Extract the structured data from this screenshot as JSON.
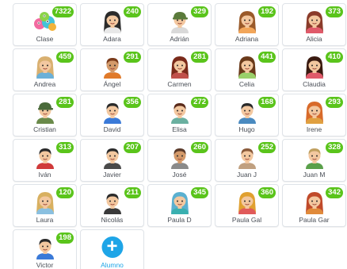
{
  "class_card": {
    "label": "Clase",
    "points": "7322"
  },
  "students": [
    {
      "name": "Adara",
      "points": "240",
      "hair": "#2b2b2b",
      "skin": "#f3c8a0",
      "shirt": "#e8e8e8",
      "hairstyle": "long"
    },
    {
      "name": "Adrián",
      "points": "329",
      "hair": "#5a7a3a",
      "skin": "#f3c8a0",
      "shirt": "#d9d9d9",
      "hairstyle": "cap"
    },
    {
      "name": "Adriana",
      "points": "192",
      "hair": "#9a5a2a",
      "skin": "#f3c8a0",
      "shirt": "#f2a65a",
      "hairstyle": "long"
    },
    {
      "name": "Alicia",
      "points": "373",
      "hair": "#8a3b2a",
      "skin": "#f3c8a0",
      "shirt": "#e05a6a",
      "hairstyle": "long"
    },
    {
      "name": "Andrea",
      "points": "459",
      "hair": "#d9b070",
      "skin": "#f3c8a0",
      "shirt": "#6ab0d8",
      "hairstyle": "long"
    },
    {
      "name": "Ángel",
      "points": "291",
      "hair": "#7a3a1a",
      "skin": "#d49a6a",
      "shirt": "#e07a2a",
      "hairstyle": "short"
    },
    {
      "name": "Carmen",
      "points": "281",
      "hair": "#7a2a1a",
      "skin": "#f3c8a0",
      "shirt": "#c0504a",
      "hairstyle": "long"
    },
    {
      "name": "Celia",
      "points": "441",
      "hair": "#6a3a1a",
      "skin": "#f3c8a0",
      "shirt": "#9ad06a",
      "hairstyle": "long"
    },
    {
      "name": "Claudia",
      "points": "410",
      "hair": "#3a1a10",
      "skin": "#f3c8a0",
      "shirt": "#e05a6a",
      "hairstyle": "long"
    },
    {
      "name": "Cristian",
      "points": "281",
      "hair": "#4a6a3a",
      "skin": "#f3c8a0",
      "shirt": "#6a8a4a",
      "hairstyle": "cap"
    },
    {
      "name": "David",
      "points": "356",
      "hair": "#2a2a2a",
      "skin": "#f3c8a0",
      "shirt": "#3a7ad8",
      "hairstyle": "short"
    },
    {
      "name": "Elisa",
      "points": "272",
      "hair": "#5a2a1a",
      "skin": "#f3c8a0",
      "shirt": "#6ab0a0",
      "hairstyle": "short"
    },
    {
      "name": "Hugo",
      "points": "168",
      "hair": "#2a2a2a",
      "skin": "#f3c8a0",
      "shirt": "#4a8ac0",
      "hairstyle": "short"
    },
    {
      "name": "Irene",
      "points": "293",
      "hair": "#d86a2a",
      "skin": "#f3c8a0",
      "shirt": "#e0a040",
      "hairstyle": "long"
    },
    {
      "name": "Iván",
      "points": "313",
      "hair": "#2a2a2a",
      "skin": "#f3c8a0",
      "shirt": "#d03a3a",
      "hairstyle": "short"
    },
    {
      "name": "Javier",
      "points": "207",
      "hair": "#2a2a2a",
      "skin": "#f3c8a0",
      "shirt": "#4a4a4a",
      "hairstyle": "short"
    },
    {
      "name": "José",
      "points": "260",
      "hair": "#5a3a2a",
      "skin": "#d49a6a",
      "shirt": "#8a8a8a",
      "hairstyle": "short"
    },
    {
      "name": "Juan J",
      "points": "252",
      "hair": "#8a5a3a",
      "skin": "#f3c8a0",
      "shirt": "#c0a080",
      "hairstyle": "short"
    },
    {
      "name": "Juan M",
      "points": "328",
      "hair": "#c0a060",
      "skin": "#f3c8a0",
      "shirt": "#5aa04a",
      "hairstyle": "short"
    },
    {
      "name": "Laura",
      "points": "120",
      "hair": "#d8b060",
      "skin": "#f3c8a0",
      "shirt": "#8ac0e0",
      "hairstyle": "long"
    },
    {
      "name": "Nicolás",
      "points": "211",
      "hair": "#2a2a2a",
      "skin": "#f3c8a0",
      "shirt": "#3a3a3a",
      "hairstyle": "short"
    },
    {
      "name": "Paula D",
      "points": "345",
      "hair": "#5ab0d0",
      "skin": "#f3c8a0",
      "shirt": "#3ab0b0",
      "hairstyle": "long"
    },
    {
      "name": "Paula Gal",
      "points": "360",
      "hair": "#e0a030",
      "skin": "#f3c8a0",
      "shirt": "#e05a5a",
      "hairstyle": "long"
    },
    {
      "name": "Paula Gar",
      "points": "342",
      "hair": "#c04a2a",
      "skin": "#f3c8a0",
      "shirt": "#e08a3a",
      "hairstyle": "long"
    },
    {
      "name": "Victor",
      "points": "198",
      "hair": "#2a2a2a",
      "skin": "#f3c8a0",
      "shirt": "#3a7ad8",
      "hairstyle": "short"
    }
  ],
  "add_student": {
    "label": "Alumno",
    "icon": "plus-icon"
  },
  "colors": {
    "badge": "#5ac41b",
    "accent": "#1ea5e7",
    "text": "#4a4f57"
  }
}
